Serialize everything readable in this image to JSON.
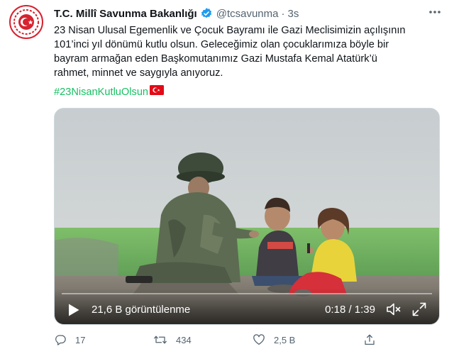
{
  "account": {
    "name": "T.C. Millî Savunma Bakanlığı",
    "handle": "@tcsavunma",
    "separator": "·",
    "time": "3s"
  },
  "tweet": {
    "lines": [
      "23 Nisan Ulusal Egemenlik ve Çocuk Bayramı ile Gazi Meclisimizin açılışının",
      "101’inci yıl dönümü kutlu olsun. Geleceğimiz olan çocuklarımıza böyle bir",
      "bayram armağan eden Başkomutanımız Gazi Mustafa Kemal Atatürk’ü",
      "rahmet, minnet ve saygıyla anıyoruz."
    ],
    "hashtag": "#23NisanKutluOlsun"
  },
  "video": {
    "views": "21,6 B görüntülenme",
    "timecode": "0:18 / 1:39",
    "progress": 0.0
  },
  "actions": {
    "replies": "17",
    "retweets": "434",
    "likes": "2,5 B"
  },
  "colors": {
    "brand_red": "#d7222f",
    "hashtag": "#17bf63",
    "verified": "#1d9bf0",
    "secondary_text": "#536471"
  },
  "icons": {
    "avatar": "ministry-emblem",
    "verified": "verified-badge-icon",
    "more": "more-dots-icon",
    "play": "play-icon",
    "volume": "volume-icon",
    "fullscreen": "fullscreen-icon",
    "reply": "reply-icon",
    "retweet": "retweet-icon",
    "like": "heart-icon",
    "share": "share-icon",
    "flag": "turkey-flag-emoji"
  }
}
